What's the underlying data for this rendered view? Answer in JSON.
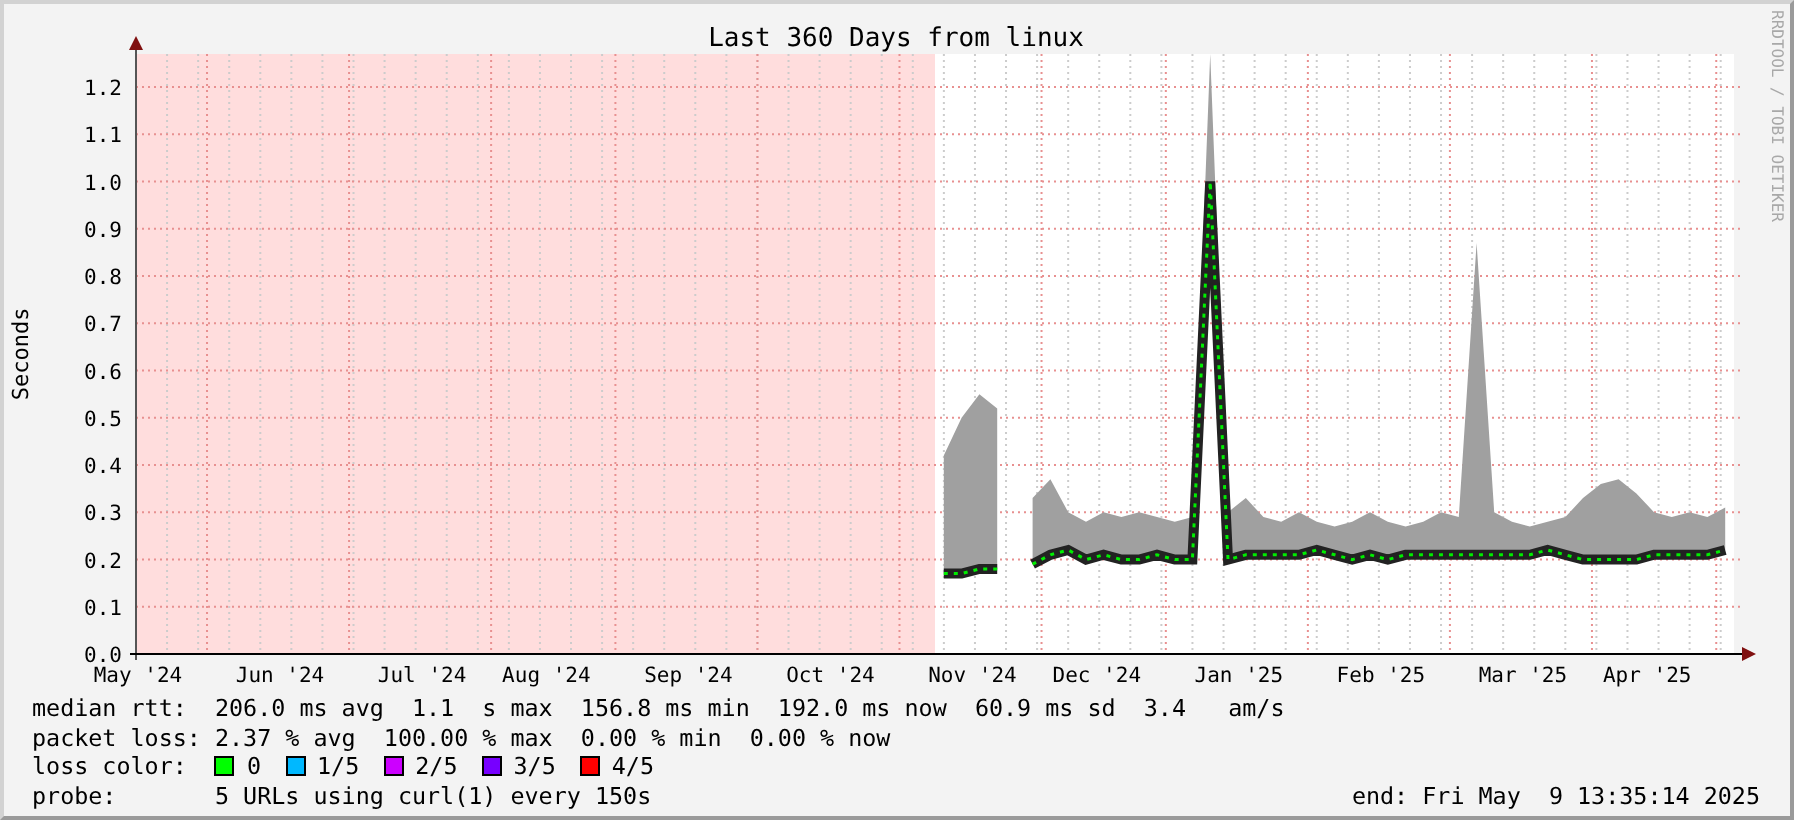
{
  "chart": {
    "credit": "RRDTOOL / TOBI OETIKER",
    "chart_data": {
      "type": "line",
      "title": "Last 360 Days from linux",
      "ylabel": "Seconds",
      "grid": true,
      "categories": [
        "May '24",
        null,
        null,
        null,
        null,
        null,
        null,
        null,
        "Jun '24",
        null,
        null,
        null,
        null,
        null,
        null,
        null,
        "Jul '24",
        null,
        null,
        null,
        null,
        null,
        null,
        "Aug '24",
        null,
        null,
        null,
        null,
        null,
        null,
        null,
        "Sep '24",
        null,
        null,
        null,
        null,
        null,
        null,
        null,
        "Oct '24",
        null,
        null,
        null,
        null,
        null,
        null,
        null,
        "Nov '24",
        null,
        null,
        null,
        null,
        null,
        null,
        "Dec '24",
        null,
        null,
        null,
        null,
        null,
        null,
        null,
        "Jan '25",
        null,
        null,
        null,
        null,
        null,
        null,
        null,
        "Feb '25",
        null,
        null,
        null,
        null,
        null,
        null,
        null,
        "Mar '25",
        null,
        null,
        null,
        null,
        null,
        null,
        "Apr '25",
        null,
        null,
        null,
        null
      ],
      "ylim": [
        0,
        1.27
      ],
      "yticks": [
        {
          "value": 0,
          "label": "0.0"
        },
        {
          "value": 0.1,
          "label": "0.1"
        },
        {
          "value": 0.2,
          "label": "0.2"
        },
        {
          "value": 0.3,
          "label": "0.3"
        },
        {
          "value": 0.4,
          "label": "0.4"
        },
        {
          "value": 0.5,
          "label": "0.5"
        },
        {
          "value": 0.6,
          "label": "0.6"
        },
        {
          "value": 0.7,
          "label": "0.7"
        },
        {
          "value": 0.8,
          "label": "0.8"
        },
        {
          "value": 0.9,
          "label": "0.9"
        },
        {
          "value": 1.0,
          "label": "1.0"
        },
        {
          "value": 1.1,
          "label": "1.1"
        },
        {
          "value": 1.2,
          "label": "1.2"
        }
      ],
      "series": [
        {
          "type": "area",
          "color": "#a0a0a0",
          "values": [
            null,
            null,
            null,
            null,
            null,
            null,
            null,
            null,
            null,
            null,
            null,
            null,
            null,
            null,
            null,
            null,
            null,
            null,
            null,
            null,
            null,
            null,
            null,
            null,
            null,
            null,
            null,
            null,
            null,
            null,
            null,
            null,
            null,
            null,
            null,
            null,
            null,
            null,
            null,
            null,
            null,
            null,
            null,
            null,
            null,
            0.42,
            0.5,
            0.55,
            0.52,
            null,
            0.33,
            0.37,
            0.3,
            0.28,
            0.3,
            0.29,
            0.3,
            0.29,
            0.28,
            0.29,
            1.27,
            0.3,
            0.33,
            0.29,
            0.28,
            0.3,
            0.28,
            0.27,
            0.28,
            0.3,
            0.28,
            0.27,
            0.28,
            0.3,
            0.29,
            0.87,
            0.3,
            0.28,
            0.27,
            0.28,
            0.29,
            0.33,
            0.36,
            0.37,
            0.34,
            0.3,
            0.29,
            0.3,
            0.29,
            0.31
          ]
        },
        {
          "type": "line",
          "line_style": "dashed",
          "color": "#00ee00",
          "values": [
            null,
            null,
            null,
            null,
            null,
            null,
            null,
            null,
            null,
            null,
            null,
            null,
            null,
            null,
            null,
            null,
            null,
            null,
            null,
            null,
            null,
            null,
            null,
            null,
            null,
            null,
            null,
            null,
            null,
            null,
            null,
            null,
            null,
            null,
            null,
            null,
            null,
            null,
            null,
            null,
            null,
            null,
            null,
            null,
            null,
            0.17,
            0.17,
            0.18,
            0.18,
            null,
            0.19,
            0.21,
            0.22,
            0.2,
            0.21,
            0.2,
            0.2,
            0.21,
            0.2,
            0.2,
            1.0,
            0.2,
            0.21,
            0.21,
            0.21,
            0.21,
            0.22,
            0.21,
            0.2,
            0.21,
            0.2,
            0.21,
            0.21,
            0.21,
            0.21,
            0.21,
            0.21,
            0.21,
            0.21,
            0.22,
            0.21,
            0.2,
            0.2,
            0.2,
            0.2,
            0.21,
            0.21,
            0.21,
            0.21,
            0.22
          ]
        }
      ]
    }
  },
  "legend": [
    {
      "kind": "stats",
      "label": "median rtt:",
      "value": "206.0 ms avg  1.1  s max  156.8 ms min  192.0 ms now  60.9 ms sd  3.4   am/s"
    },
    {
      "kind": "stats",
      "label": "packet loss:",
      "value": "2.37 % avg  100.00 % max  0.00 % min  0.00 % now"
    },
    {
      "kind": "swatches",
      "label": "loss color:",
      "swatches": [
        {
          "text": "0",
          "color": "#00ff00"
        },
        {
          "text": "1/5",
          "color": "#00b8ff"
        },
        {
          "text": "2/5",
          "color": "#cc00ff"
        },
        {
          "text": "3/5",
          "color": "#7700ff"
        },
        {
          "text": "4/5",
          "color": "#ff0000"
        }
      ]
    },
    {
      "kind": "stats",
      "label": "probe:",
      "value": "5 URLs using curl(1) every 150s",
      "right": "end: Fri May  9 13:35:14 2025"
    }
  ]
}
